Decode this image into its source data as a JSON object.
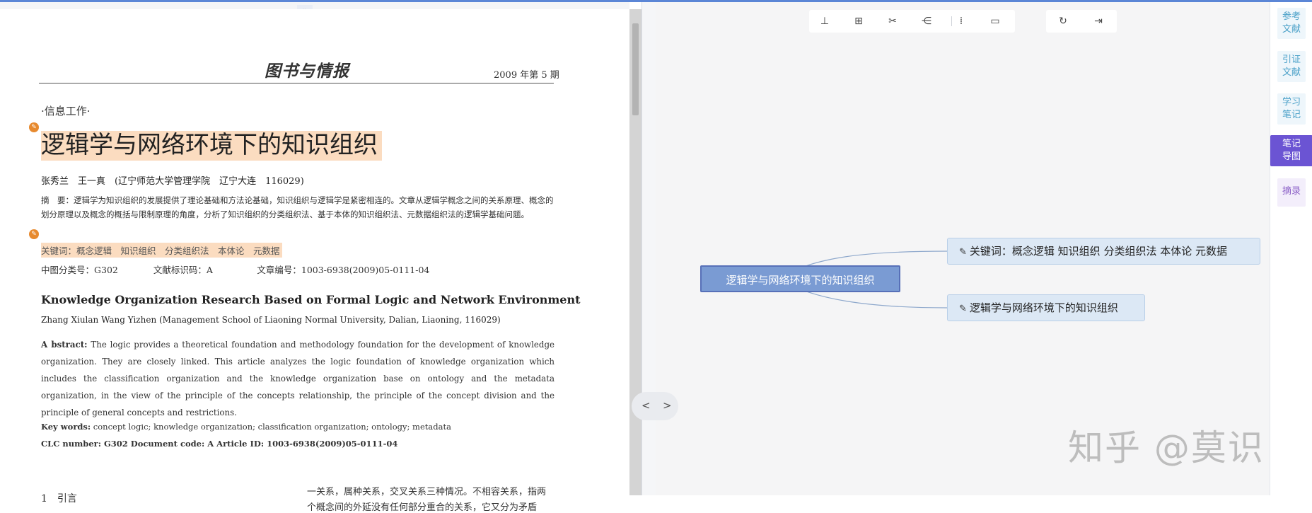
{
  "pdf_page": {
    "journal_logo": "图书与情报",
    "issue": "2009 年第 5 期",
    "section": "·信息工作·",
    "title": "逻辑学与网络环境下的知识组织",
    "authors": "张秀兰　王一真　(辽宁师范大学管理学院　辽宁大连　116029)",
    "abstract_cn": "摘　要：逻辑学为知识组织的发展提供了理论基础和方法论基础，知识组织与逻辑学是紧密相连的。文章从逻辑学概念之间的关系原理、概念的划分原理以及概念的概括与限制原理的角度，分析了知识组织的分类组织法、基于本体的知识组织法、元数据组织法的逻辑学基础问题。",
    "keywords_cn": "关键词：概念逻辑　知识组织　分类组织法　本体论　元数据",
    "classification_cn": "中图分类号：G302　　　　文献标识码：A　　　　　文章编号：1003-6938(2009)05-0111-04",
    "en_title": "Knowledge Organization Research Based on Formal Logic and Network Environment",
    "en_authors": "Zhang Xiulan   Wang Yizhen  (Management School of Liaoning Normal University, Dalian, Liaoning, 116029)",
    "en_abstract_label": "A bstract:",
    "en_abstract": " The logic provides a theoretical foundation and methodology foundation for the development of knowledge organization. They are closely linked. This article analyzes the logic foundation of knowledge organization which includes the classification organization and the knowledge organization base on ontology and the metadata organization, in the view of the principle of the concepts relationship, the principle of the concept division and the principle of general concepts and restrictions.",
    "en_keywords_label": "Key words:",
    "en_keywords": " concept logic; knowledge organization; classification organization; ontology; metadata",
    "en_clc": "CLC number: G302              Document code: A               Article ID: 1003-6938(2009)05-0111-04",
    "intro_heading": "1　引言",
    "body_line_1": "一关系，属种关系，交叉关系三种情况。不相容关系，指两",
    "body_line_2": "个概念间的外延没有任何部分重合的关系，它又分为矛盾"
  },
  "reader_ui": {
    "collapse_icon": "»",
    "prev_label": "<",
    "next_label": ">"
  },
  "mindmap": {
    "toolbar_icons": [
      "hierarchy-icon",
      "structure-icon",
      "tools-icon",
      "share-nodes-icon",
      "split-icon",
      "comment-icon",
      "refresh-icon",
      "exit-icon"
    ],
    "toolbar_glyphs": [
      "⊥",
      "⊞",
      "✂",
      "⋲",
      "⁞",
      "▭",
      "↻",
      "⇥"
    ],
    "root": "逻辑学与网络环境下的知识组织",
    "children": [
      "关键词：概念逻辑 知识组织 分类组织法 本体论 元数据",
      "逻辑学与网络环境下的知识组织"
    ],
    "child_icon": "✎",
    "watermark": "知乎 @莫识"
  },
  "side_tabs": [
    "参考文献",
    "引证文献",
    "学习笔记",
    "笔记导图",
    "摘录"
  ],
  "colors": {
    "highlight": "#fbdcc0",
    "root_node": "#7a9bd3",
    "child_node": "#dce8f5",
    "active_tab": "#6b54d3"
  }
}
